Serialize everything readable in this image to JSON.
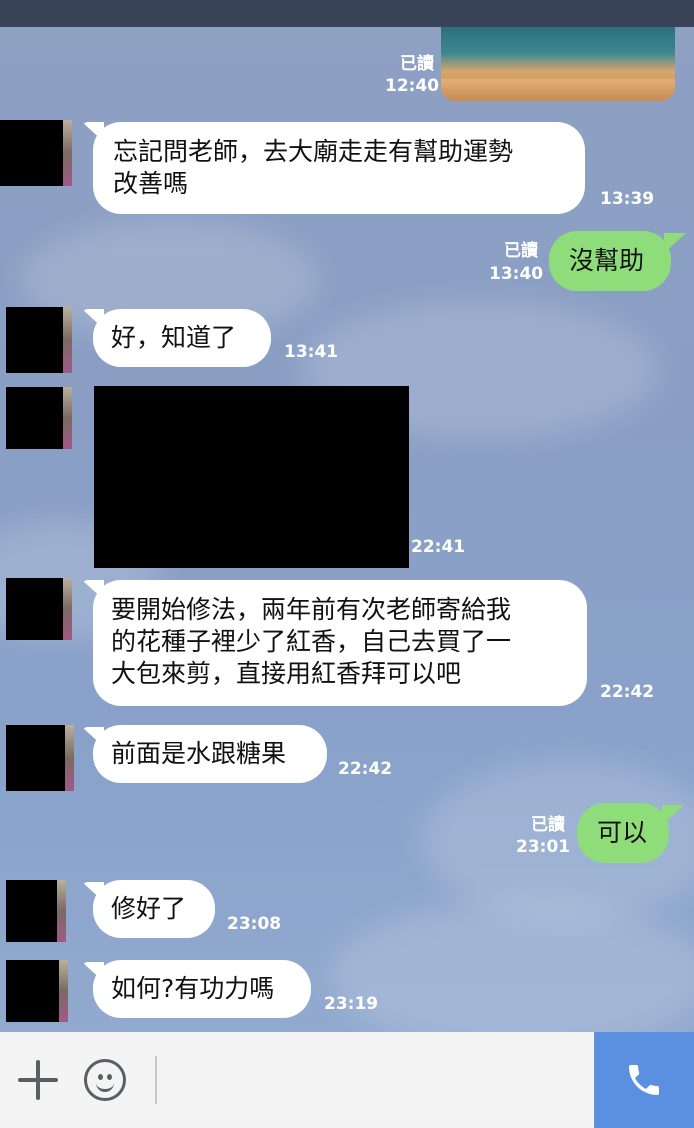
{
  "messages": [
    {
      "text": "忘記問老師，去大廟走走有幫助運勢\n改善嗎",
      "time": "13:39"
    },
    {
      "text": "沒幫助",
      "time": "13:40",
      "read": "已讀"
    },
    {
      "text": "好，知道了",
      "time": "13:41"
    },
    {
      "time": "22:41"
    },
    {
      "text": "要開始修法，兩年前有次老師寄給我\n的花種子裡少了紅香，自己去買了一\n大包來剪，直接用紅香拜可以吧",
      "time": "22:42"
    },
    {
      "text": "前面是水跟糖果",
      "time": "22:42"
    },
    {
      "text": "可以",
      "time": "23:01",
      "read": "已讀"
    },
    {
      "text": "修好了",
      "time": "23:08"
    },
    {
      "text": "如何?有功力嗎",
      "time": "23:19"
    }
  ],
  "top_photo": {
    "read": "已讀",
    "time": "12:40"
  },
  "input_bar": {
    "plus_icon": "plus-icon",
    "emoji_icon": "smile-icon",
    "call_icon": "phone-icon"
  },
  "colors": {
    "outgoing_bubble": "#8fdd7a",
    "incoming_bubble": "#ffffff",
    "call_button": "#5b8fe0",
    "top_bar": "#3a4459"
  }
}
